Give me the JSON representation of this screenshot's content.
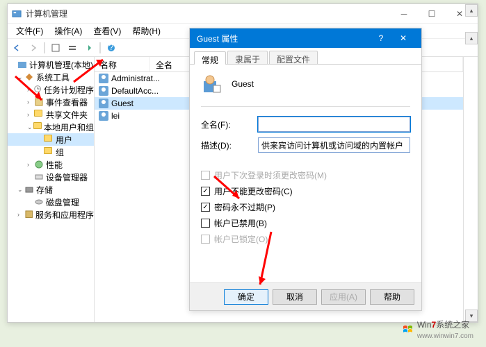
{
  "main": {
    "title": "计算机管理",
    "menus": [
      "文件(F)",
      "操作(A)",
      "查看(V)",
      "帮助(H)"
    ]
  },
  "tree": {
    "root": "计算机管理(本地)",
    "systools": "系统工具",
    "task": "任务计划程序",
    "event": "事件查看器",
    "shared": "共享文件夹",
    "localusers": "本地用户和组",
    "users": "用户",
    "groups": "组",
    "perf": "性能",
    "devmgr": "设备管理器",
    "storage": "存储",
    "diskmgr": "磁盘管理",
    "services": "服务和应用程序"
  },
  "list": {
    "col_name": "名称",
    "col_full": "全名",
    "rows": [
      {
        "name": "Administrat..."
      },
      {
        "name": "DefaultAcc..."
      },
      {
        "name": "Guest"
      },
      {
        "name": "lei"
      }
    ]
  },
  "dialog": {
    "title": "Guest 属性",
    "tabs": {
      "general": "常规",
      "memberof": "隶属于",
      "profile": "配置文件"
    },
    "username": "Guest",
    "fullname_label": "全名(F):",
    "fullname_value": "",
    "desc_label": "描述(D):",
    "desc_value": "供来宾访问计算机或访问域的内置帐户",
    "chk_must_change": "用户下次登录时须更改密码(M)",
    "chk_cannot_change": "用户不能更改密码(C)",
    "chk_never_expire": "密码永不过期(P)",
    "chk_disabled": "帐户已禁用(B)",
    "chk_locked": "帐户已锁定(O)",
    "btn_ok": "确定",
    "btn_cancel": "取消",
    "btn_apply": "应用(A)",
    "btn_help": "帮助"
  },
  "watermark": {
    "text1": "Win",
    "text2": "7",
    "text3": "系统之家",
    "url": "www.winwin7.com"
  }
}
